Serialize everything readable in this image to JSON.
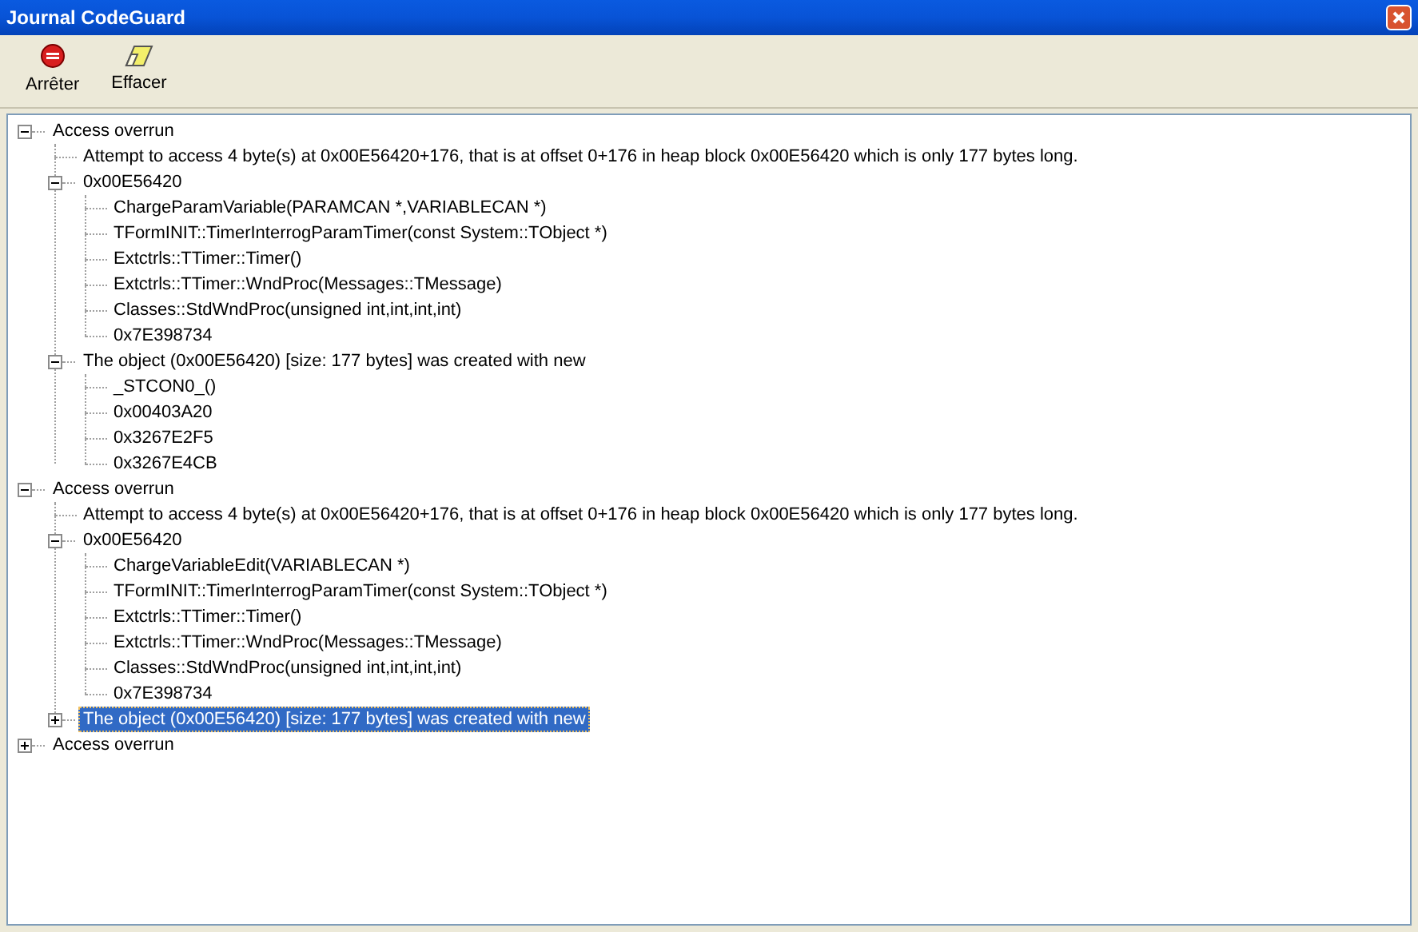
{
  "window": {
    "title": "Journal CodeGuard"
  },
  "toolbar": [
    {
      "kind": "stop",
      "label": "Arrêter"
    },
    {
      "kind": "erase",
      "label": "Effacer"
    }
  ],
  "tree": [
    {
      "label": "Access overrun",
      "expanded": true,
      "selected": false,
      "children": [
        {
          "label": "Attempt to access 4 byte(s) at 0x00E56420+176, that is at offset 0+176 in heap block 0x00E56420 which is only 177 bytes long.",
          "selected": false
        },
        {
          "label": "0x00E56420",
          "expanded": true,
          "selected": false,
          "children": [
            {
              "label": "ChargeParamVariable(PARAMCAN *,VARIABLECAN *)",
              "selected": false
            },
            {
              "label": "TFormINIT::TimerInterrogParamTimer(const System::TObject *)",
              "selected": false
            },
            {
              "label": "Extctrls::TTimer::Timer()",
              "selected": false
            },
            {
              "label": "Extctrls::TTimer::WndProc(Messages::TMessage)",
              "selected": false
            },
            {
              "label": "Classes::StdWndProc(unsigned int,int,int,int)",
              "selected": false
            },
            {
              "label": "0x7E398734",
              "selected": false
            }
          ]
        },
        {
          "label": "The object (0x00E56420) [size: 177 bytes] was created with new",
          "expanded": true,
          "selected": false,
          "children": [
            {
              "label": "_STCON0_()",
              "selected": false
            },
            {
              "label": "0x00403A20",
              "selected": false
            },
            {
              "label": "0x3267E2F5",
              "selected": false
            },
            {
              "label": "0x3267E4CB",
              "selected": false
            }
          ]
        }
      ]
    },
    {
      "label": "Access overrun",
      "expanded": true,
      "selected": false,
      "children": [
        {
          "label": "Attempt to access 4 byte(s) at 0x00E56420+176, that is at offset 0+176 in heap block 0x00E56420 which is only 177 bytes long.",
          "selected": false
        },
        {
          "label": "0x00E56420",
          "expanded": true,
          "selected": false,
          "children": [
            {
              "label": "ChargeVariableEdit(VARIABLECAN *)",
              "selected": false
            },
            {
              "label": "TFormINIT::TimerInterrogParamTimer(const System::TObject *)",
              "selected": false
            },
            {
              "label": "Extctrls::TTimer::Timer()",
              "selected": false
            },
            {
              "label": "Extctrls::TTimer::WndProc(Messages::TMessage)",
              "selected": false
            },
            {
              "label": "Classes::StdWndProc(unsigned int,int,int,int)",
              "selected": false
            },
            {
              "label": "0x7E398734",
              "selected": false
            }
          ]
        },
        {
          "label": "The object (0x00E56420) [size: 177 bytes] was created with new",
          "expanded": false,
          "selected": true
        }
      ]
    },
    {
      "label": "Access overrun",
      "expanded": false,
      "selected": false
    }
  ]
}
